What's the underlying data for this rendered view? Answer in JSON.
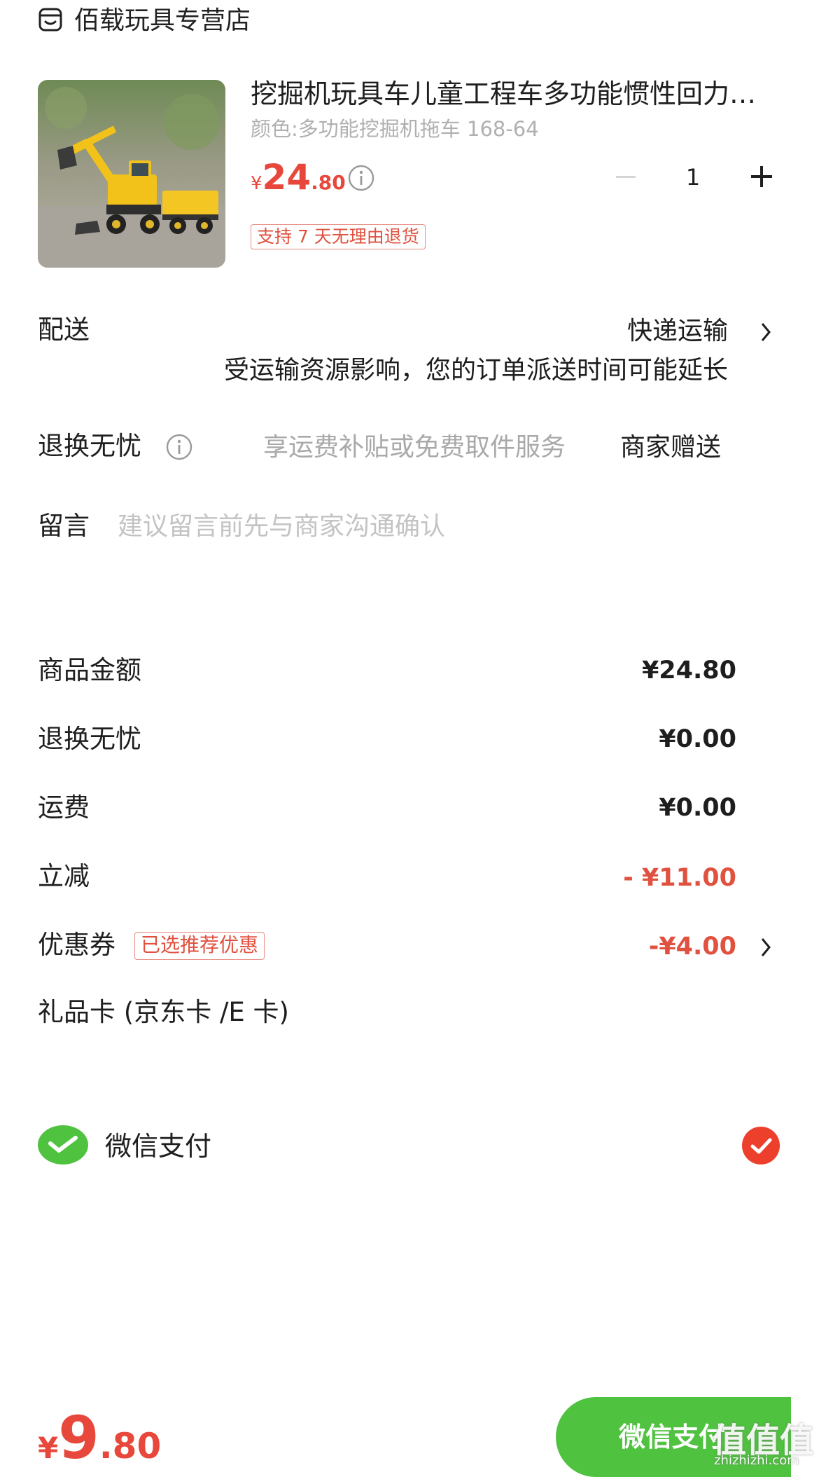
{
  "store": {
    "name": "佰载玩具专营店",
    "icon": "store-icon"
  },
  "product": {
    "title": "挖掘机玩具车儿童工程车多功能惯性回力…",
    "spec": "颜色:多功能挖掘机拖车 168-64",
    "price_currency": "¥",
    "price_int": "24",
    "price_dec": ".80",
    "quantity": "1",
    "return_tag": "支持 7 天无理由退货"
  },
  "delivery": {
    "label": "配送",
    "method": "快递运输",
    "notice": "受运输资源影响，您的订单派送时间可能延长"
  },
  "worry_free": {
    "label": "退换无忧",
    "hint": "享运费补贴或免费取件服务",
    "value": "商家赠送"
  },
  "message": {
    "label": "留言",
    "placeholder": "建议留言前先与商家沟通确认"
  },
  "amounts": {
    "goods_label": "商品金额",
    "goods_value": "¥24.80",
    "worry_label": "退换无忧",
    "worry_value": "¥0.00",
    "shipping_label": "运费",
    "shipping_value": "¥0.00",
    "discount_label": "立减",
    "discount_value": "- ¥11.00",
    "coupon_label": "优惠券",
    "coupon_tag": "已选推荐优惠",
    "coupon_value": "-¥4.00",
    "giftcard_label": "礼品卡 (京东卡 /E 卡)"
  },
  "payment": {
    "method": "微信支付",
    "selected": true
  },
  "bottom": {
    "total_currency": "¥",
    "total_int": "9",
    "total_dec": ".80",
    "pay_button": "微信支付",
    "watermark": "值值值",
    "watermark_sub": "zhizhizhi.com"
  },
  "colors": {
    "accent_red": "#e0513f",
    "wechat_green": "#4fc23f",
    "check_red": "#ec3f2c"
  }
}
